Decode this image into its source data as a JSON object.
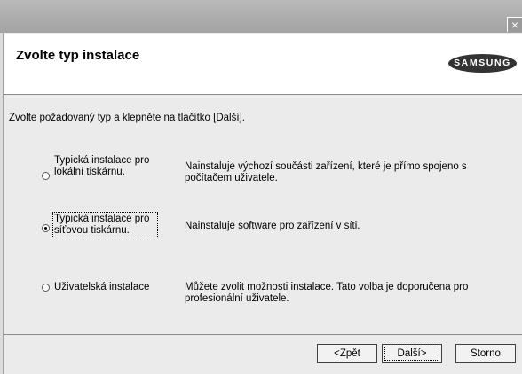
{
  "window": {
    "close_label": "×"
  },
  "header": {
    "title": "Zvolte typ instalace",
    "logo": "SAMSUNG"
  },
  "main": {
    "prompt": "Zvolte požadovaný typ a klepněte na tlačítko [Další].",
    "options": [
      {
        "label_line1": "Typická instalace pro",
        "label_line2": "lokální tiskárnu.",
        "desc_line1": "Nainstaluje výchozí součásti zařízení, které je přímo spojeno s",
        "desc_line2": "počítačem uživatele.",
        "checked": false
      },
      {
        "label_line1": "Typická instalace pro",
        "label_line2": "síťovou tiskárnu.",
        "desc_line1": "Nainstaluje software pro zařízení v síti.",
        "desc_line2": "",
        "checked": true
      },
      {
        "label_line1": "Uživatelská instalace",
        "label_line2": "",
        "desc_line1": "Můžete zvolit možnosti instalace. Tato volba je doporučena pro",
        "desc_line2": "profesionální uživatele.",
        "checked": false
      }
    ]
  },
  "footer": {
    "back_label": "<Zpět",
    "next_label": "Další>",
    "cancel_label": "Storno"
  }
}
